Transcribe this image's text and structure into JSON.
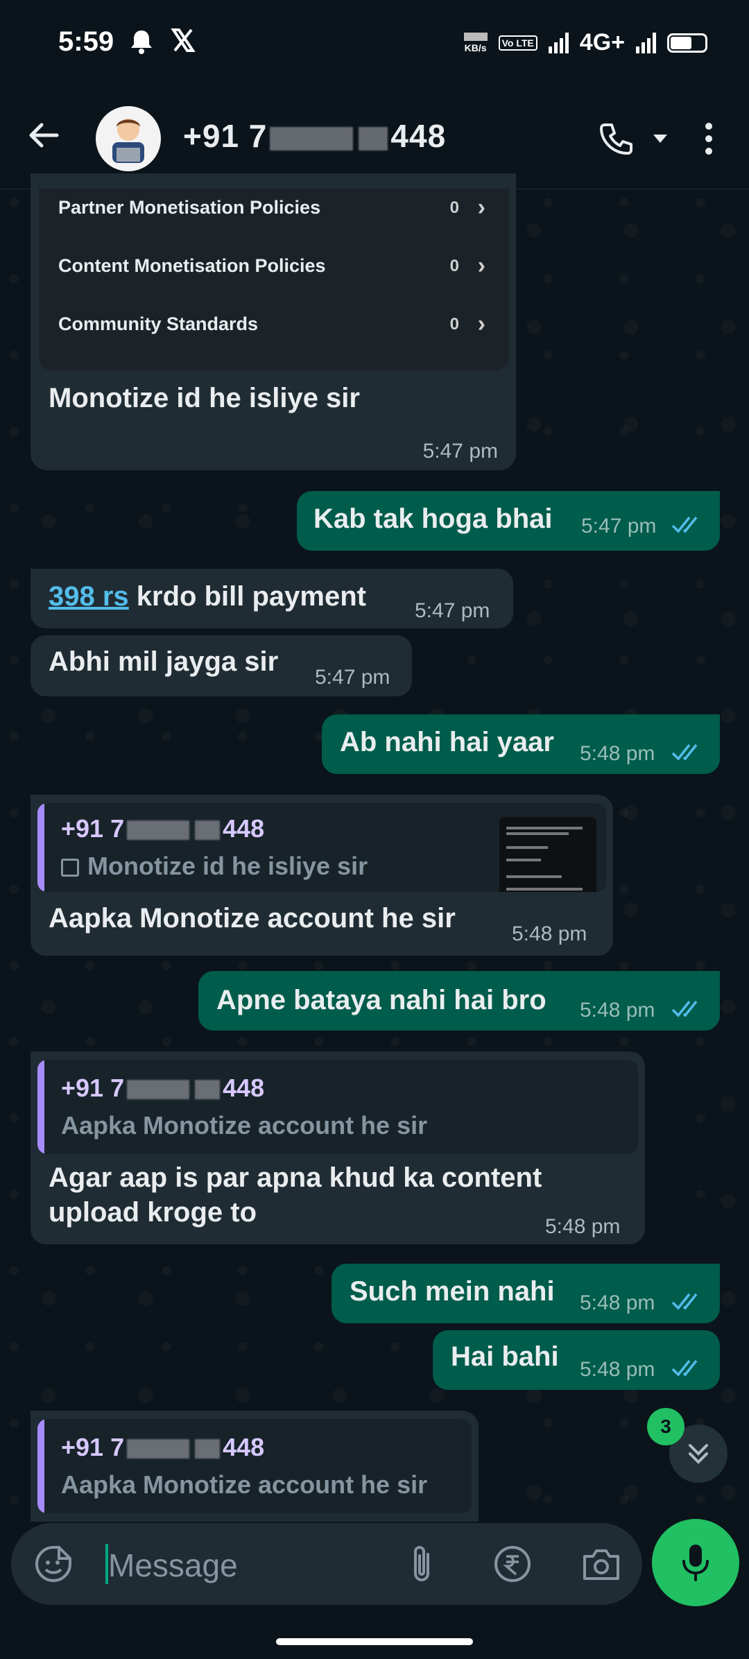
{
  "status_bar": {
    "time": "5:59",
    "speed_unit": "KB/s",
    "volte": "Vo LTE",
    "network": "4G+"
  },
  "header": {
    "contact_prefix": "+91 7",
    "contact_suffix": "448"
  },
  "policy_card": {
    "rows": [
      {
        "label": "Partner Monetisation Policies",
        "count": "0"
      },
      {
        "label": "Content Monetisation Policies",
        "count": "0"
      },
      {
        "label": "Community Standards",
        "count": "0"
      }
    ]
  },
  "messages": [
    {
      "text": "Monotize id he isliye sir",
      "time": "5:47 pm"
    },
    {
      "text": "Kab tak hoga bhai",
      "time": "5:47 pm"
    },
    {
      "link": "398 rs",
      "text": " krdo bill payment",
      "time": "5:47 pm"
    },
    {
      "text": "Abhi mil jayga sir",
      "time": "5:47 pm"
    },
    {
      "text": "Ab nahi hai yaar",
      "time": "5:48 pm"
    },
    {
      "quote_name": "+91 7",
      "quote_suffix": "448",
      "quote_text": "Monotize id he isliye sir",
      "text": "Aapka Monotize account he sir",
      "time": "5:48 pm"
    },
    {
      "text": "Apne bataya nahi hai bro",
      "time": "5:48 pm"
    },
    {
      "quote_name": "+91 7",
      "quote_suffix": "448",
      "quote_text": "Aapka Monotize account he sir",
      "text_line1": "Agar aap is par apna khud ka content",
      "text_line2": "upload kroge to",
      "time": "5:48 pm"
    },
    {
      "text": "Such mein nahi",
      "time": "5:48 pm"
    },
    {
      "text": "Hai bahi",
      "time": "5:48 pm"
    },
    {
      "quote_name": "+91 7",
      "quote_suffix": "448",
      "quote_text": "Aapka Monotize account he sir"
    }
  ],
  "unread_badge": "3",
  "input": {
    "placeholder": "Message"
  },
  "colors": {
    "incoming": "#202c33",
    "outgoing": "#005c4b",
    "accent": "#21c063",
    "tick": "#53bdeb"
  }
}
